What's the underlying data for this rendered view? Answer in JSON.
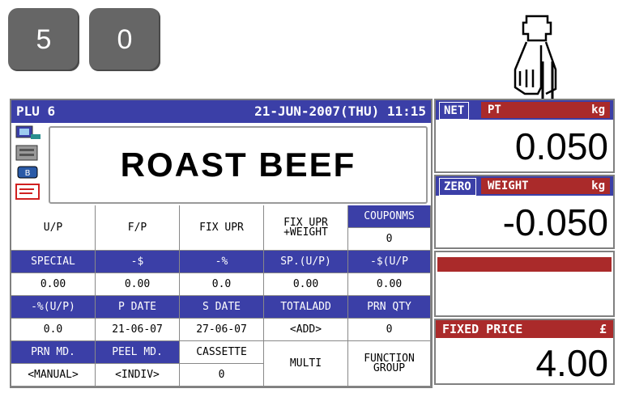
{
  "keys": [
    "5",
    "0"
  ],
  "header": {
    "plu": "PLU 6",
    "datetime": "21-JUN-2007(THU) 11:15"
  },
  "item_name": "ROAST BEEF",
  "grid": {
    "row1": {
      "u_p": "U/P",
      "f_p": "F/P",
      "fix_upr": "FIX UPR",
      "fix_upr_weight_1": "FIX UPR",
      "fix_upr_weight_2": "+WEIGHT",
      "couponms": "COUPONMS",
      "couponms_val": "0"
    },
    "row2_labels": [
      "SPECIAL",
      "-$",
      "-%",
      "SP.(U/P)",
      "-$(U/P"
    ],
    "row2_values": [
      "0.00",
      "0.00",
      "0.0",
      "0.00",
      "0.00"
    ],
    "row3_labels": [
      "-%(U/P)",
      "P DATE",
      "S DATE",
      "TOTALADD",
      "PRN QTY"
    ],
    "row3_values": [
      "0.0",
      "21-06-07",
      "27-06-07",
      "<ADD>",
      "0"
    ],
    "row4": {
      "prn_md": "PRN MD.",
      "prn_md_val": "<MANUAL>",
      "peel_md": "PEEL MD.",
      "peel_md_val": "<INDIV>",
      "cassette": "CASSETTE",
      "cassette_val": "0",
      "multi": "MULTI",
      "function_1": "FUNCTION",
      "function_2": "GROUP"
    }
  },
  "right": {
    "net_badge": "NET",
    "pt_label": "PT",
    "pt_unit": "kg",
    "pt_value": "0.050",
    "zero_badge": "ZERO",
    "weight_label": "WEIGHT",
    "weight_unit": "kg",
    "weight_value": "-0.050",
    "fixed_price_label": "FIXED PRICE",
    "currency": "£",
    "fixed_price_value": "4.00"
  },
  "colors": {
    "blue": "#3b3fa7",
    "red": "#aa2a2a",
    "key_gray": "#666666"
  }
}
